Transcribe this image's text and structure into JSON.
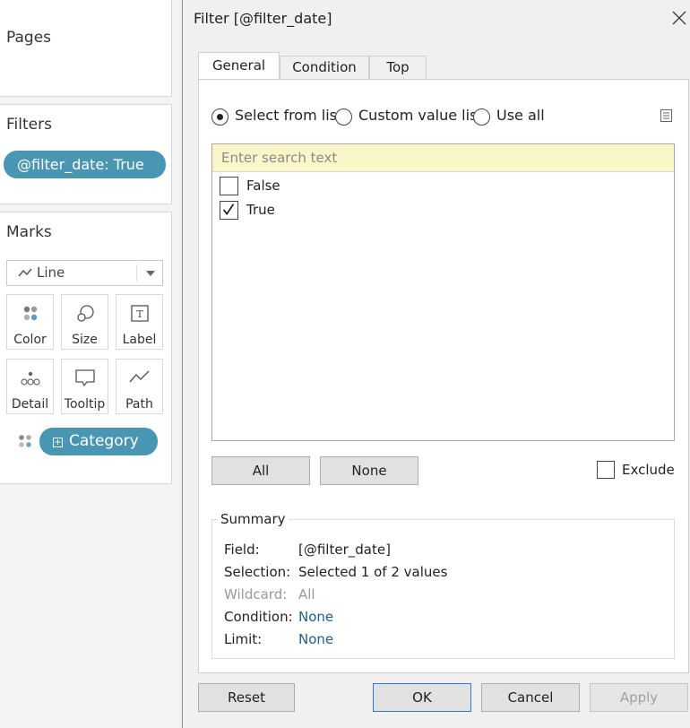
{
  "shelves": {
    "pages_title": "Pages",
    "filters_title": "Filters",
    "filter_pill": "@filter_date: True",
    "marks_title": "Marks",
    "mark_type": "Line",
    "mark_buttons": [
      {
        "label": "Color",
        "icon": "color-dots-icon"
      },
      {
        "label": "Size",
        "icon": "size-circles-icon"
      },
      {
        "label": "Label",
        "icon": "label-text-icon"
      },
      {
        "label": "Detail",
        "icon": "detail-dots-icon"
      },
      {
        "label": "Tooltip",
        "icon": "tooltip-bubble-icon"
      },
      {
        "label": "Path",
        "icon": "path-line-icon"
      }
    ],
    "category_pill": "Category"
  },
  "dialog": {
    "title": "Filter [@filter_date]",
    "tabs": [
      "General",
      "Condition",
      "Top"
    ],
    "active_tab": "General",
    "radios": [
      {
        "label": "Select from list",
        "selected": true
      },
      {
        "label": "Custom value list",
        "selected": false
      },
      {
        "label": "Use all",
        "selected": false
      }
    ],
    "search_placeholder": "Enter search text",
    "items": [
      {
        "label": "False",
        "checked": false
      },
      {
        "label": "True",
        "checked": true
      }
    ],
    "all_label": "All",
    "none_label": "None",
    "exclude_label": "Exclude",
    "summary": {
      "legend": "Summary",
      "field_key": "Field:",
      "field_val": "[@filter_date]",
      "selection_key": "Selection:",
      "selection_val": "Selected 1 of 2 values",
      "wildcard_key": "Wildcard:",
      "wildcard_val": "All",
      "condition_key": "Condition:",
      "condition_val": "None",
      "limit_key": "Limit:",
      "limit_val": "None"
    },
    "reset_label": "Reset",
    "ok_label": "OK",
    "cancel_label": "Cancel",
    "apply_label": "Apply"
  },
  "colors": {
    "pill": "#4996b2",
    "search_bg": "#fbf6c7",
    "link": "#1f5d8f"
  }
}
